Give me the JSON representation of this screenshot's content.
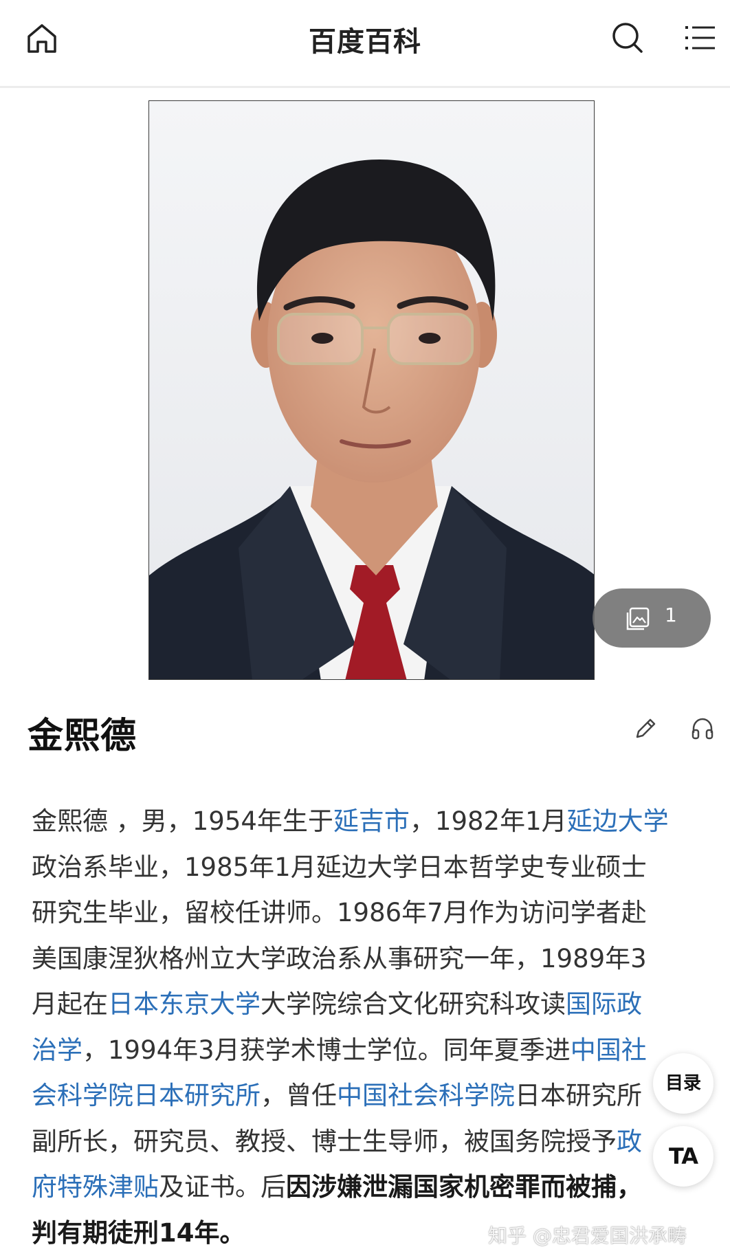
{
  "header": {
    "title": "百度百科",
    "icons": {
      "home": "home-icon",
      "search": "search-icon",
      "menu": "menu-icon"
    }
  },
  "portrait": {
    "gallery_count": "1",
    "gallery_icon": "image-gallery-icon"
  },
  "entry": {
    "title": "金熙德",
    "icons": {
      "edit": "pencil-icon",
      "audio": "headphones-icon"
    }
  },
  "summary": {
    "lines": [
      [
        {
          "t": "金熙德 ，男，1954年生于",
          "k": "text"
        },
        {
          "t": "延吉市",
          "k": "link"
        },
        {
          "t": "，1982年1月",
          "k": "text"
        },
        {
          "t": "延边大学",
          "k": "link"
        }
      ],
      [
        {
          "t": "政治系毕业，1985年1月延边大学日本哲学史专业硕士",
          "k": "text"
        }
      ],
      [
        {
          "t": "研究生毕业，留校任讲师。1986年7月作为访问学者赴",
          "k": "text"
        }
      ],
      [
        {
          "t": "美国康涅狄格州立大学政治系从事研究一年，1989年3",
          "k": "text"
        }
      ],
      [
        {
          "t": "月起在",
          "k": "text"
        },
        {
          "t": "日本东京大学",
          "k": "link"
        },
        {
          "t": "大学院综合文化研究科攻读",
          "k": "text"
        },
        {
          "t": "国际政",
          "k": "link"
        }
      ],
      [
        {
          "t": "治学",
          "k": "link"
        },
        {
          "t": "，1994年3月获学术博士学位。同年夏季进",
          "k": "text"
        },
        {
          "t": "中国社",
          "k": "link"
        }
      ],
      [
        {
          "t": "会科学院日本研究所",
          "k": "link"
        },
        {
          "t": "，曾任",
          "k": "text"
        },
        {
          "t": "中国社会科学院",
          "k": "link"
        },
        {
          "t": "日本研究所",
          "k": "text"
        }
      ],
      [
        {
          "t": "副所长，研究员、教授、博士生导师，被国务院授予",
          "k": "text"
        },
        {
          "t": "政",
          "k": "link"
        }
      ],
      [
        {
          "t": "府特殊津贴",
          "k": "link"
        },
        {
          "t": "及证书。后",
          "k": "text"
        },
        {
          "t": "因涉嫌泄漏国家机密罪而被捕，",
          "k": "bold"
        }
      ],
      [
        {
          "t": "判有期徒刑14年。",
          "k": "bold"
        }
      ]
    ]
  },
  "floating": {
    "toc_label": "目录",
    "font_label": "TA"
  },
  "watermark": {
    "text": "知乎 @忠君爱国洪承畴"
  },
  "colors": {
    "link": "#2b6fb8",
    "text": "#333333",
    "title": "#111111"
  }
}
